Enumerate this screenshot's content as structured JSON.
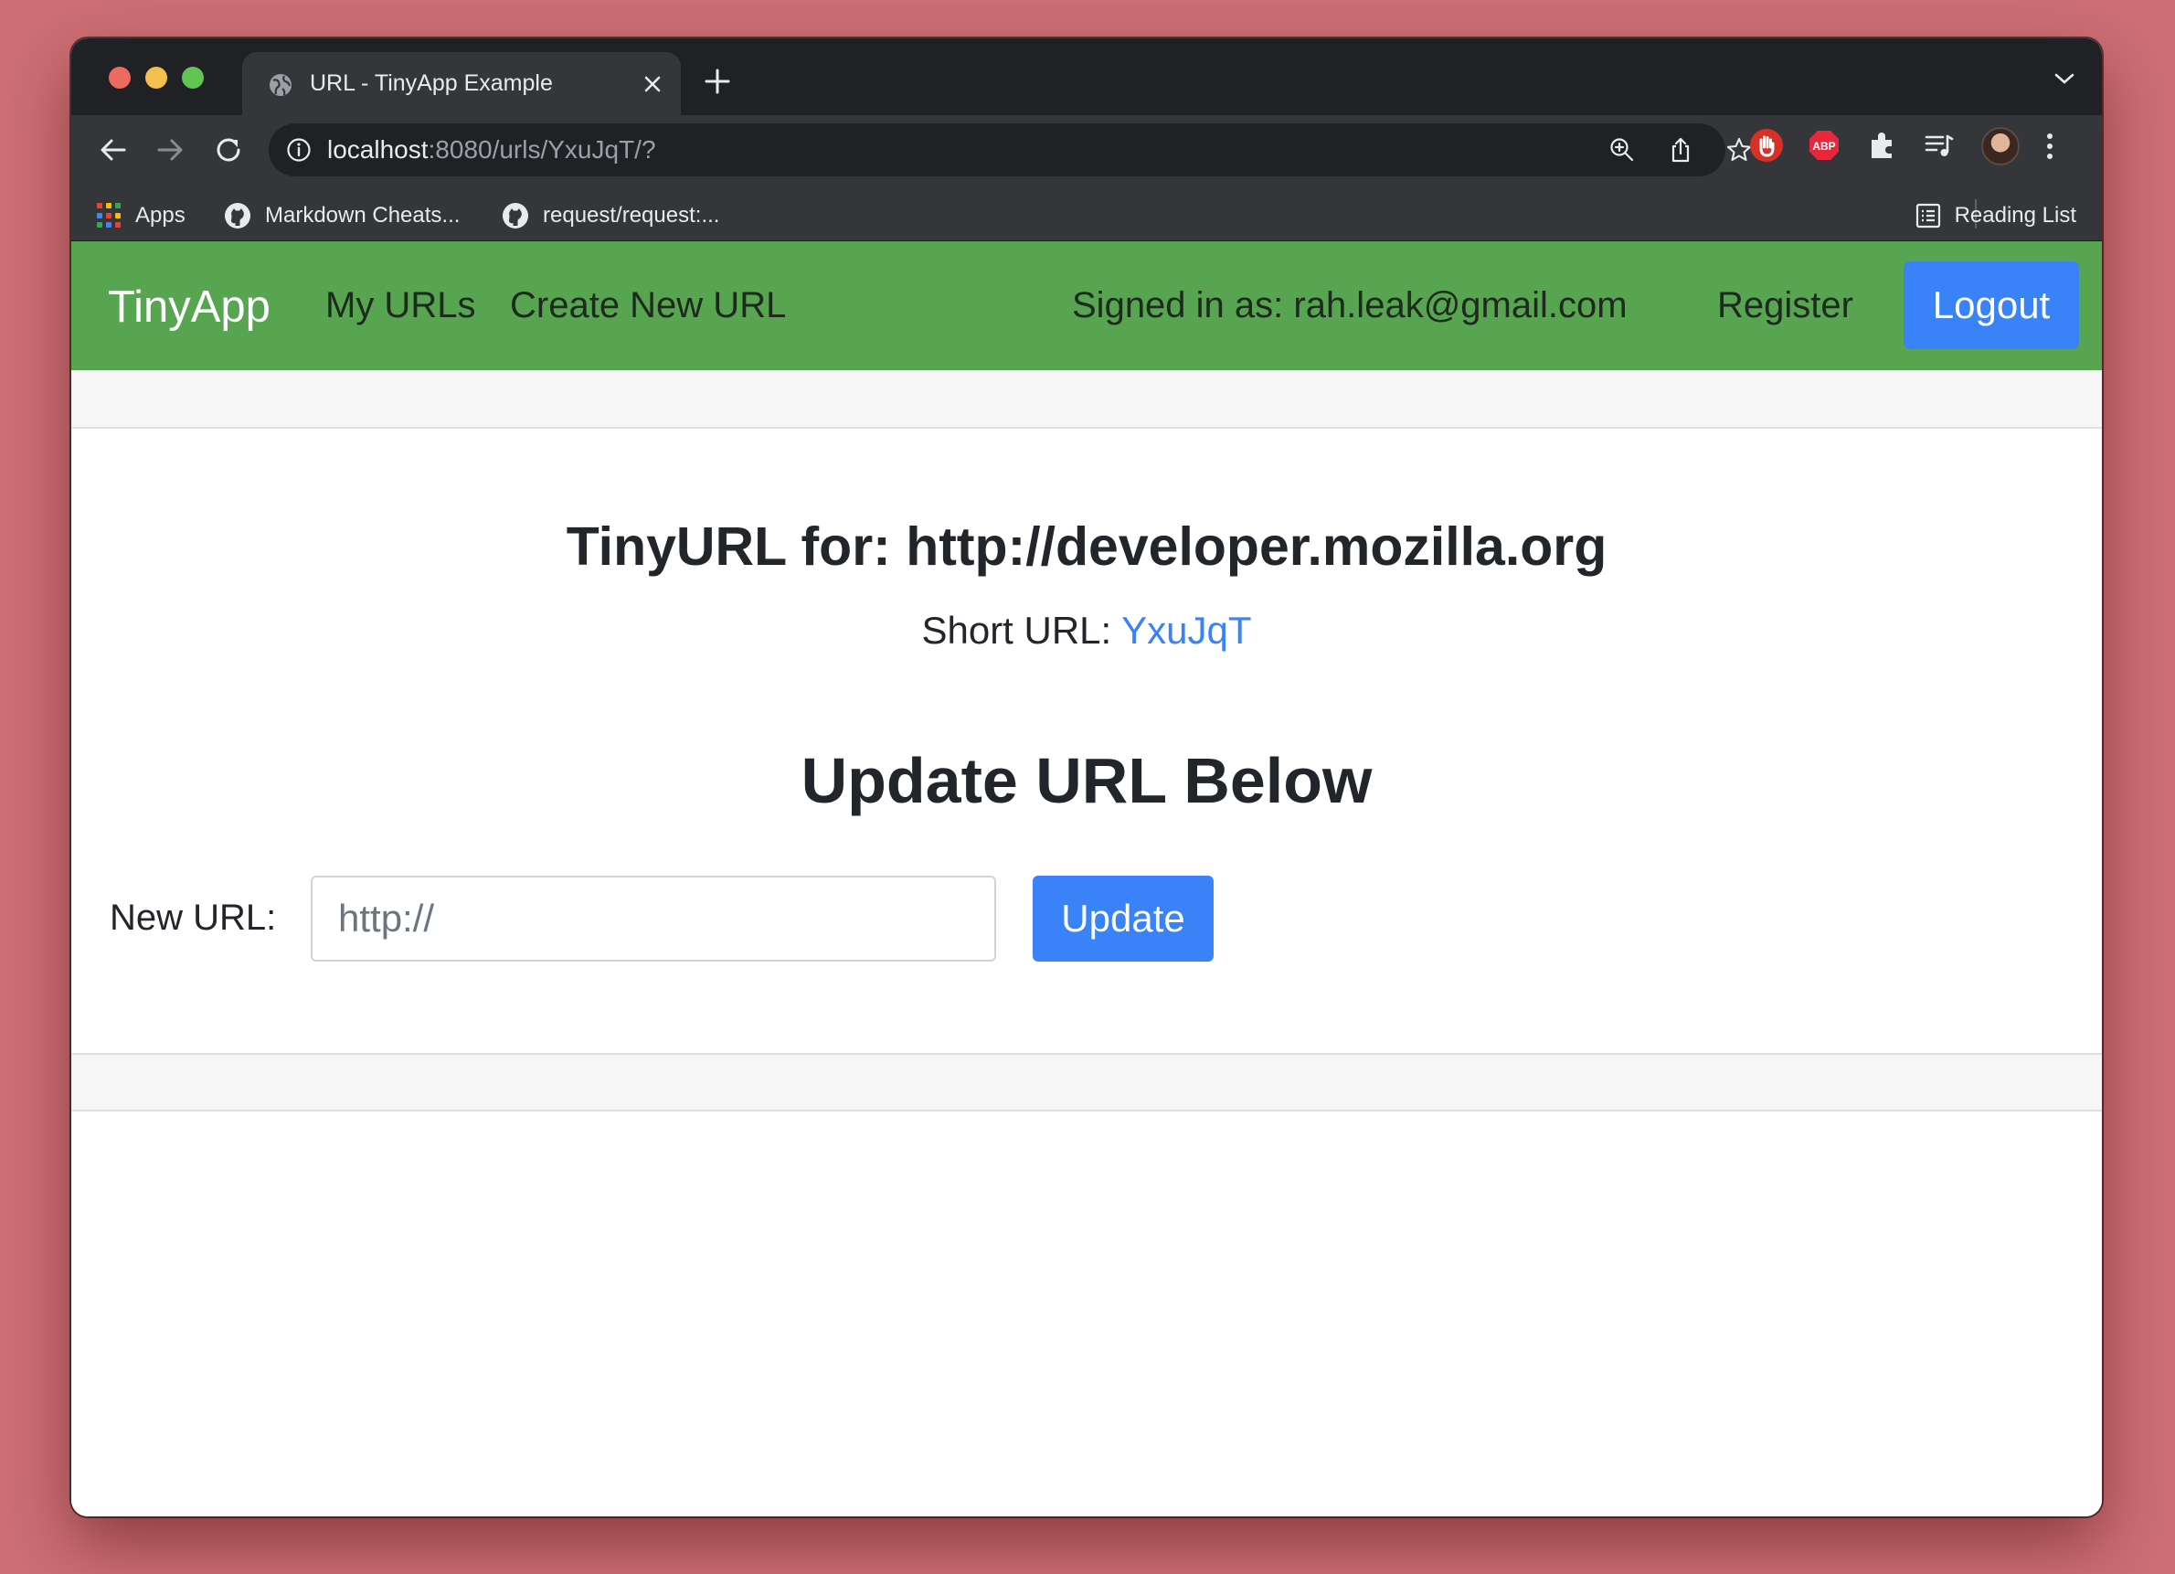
{
  "browser": {
    "tab_title": "URL - TinyApp Example",
    "url_host": "localhost",
    "url_path": ":8080/urls/YxuJqT/?",
    "bookmarks": [
      {
        "label": "Apps",
        "icon": "apps-grid-icon"
      },
      {
        "label": "Markdown Cheats...",
        "icon": "github-icon"
      },
      {
        "label": "request/request:...",
        "icon": "github-icon"
      }
    ],
    "reading_list": "Reading List",
    "extensions": {
      "abp_text": "ABP"
    }
  },
  "nav": {
    "brand": "TinyApp",
    "my_urls": "My URLs",
    "create_new": "Create New URL",
    "signed_in": "Signed in as: rah.leak@gmail.com",
    "register": "Register",
    "logout": "Logout"
  },
  "main": {
    "heading": "TinyURL for: http://developer.mozilla.org",
    "short_label": "Short URL: ",
    "short_value": "YxuJqT",
    "update_heading": "Update URL Below",
    "form": {
      "label": "New URL:",
      "placeholder": "http://",
      "button": "Update"
    }
  },
  "colors": {
    "navbar": "#57a550",
    "primary": "#3a82f7",
    "background": "#cd6f75"
  }
}
